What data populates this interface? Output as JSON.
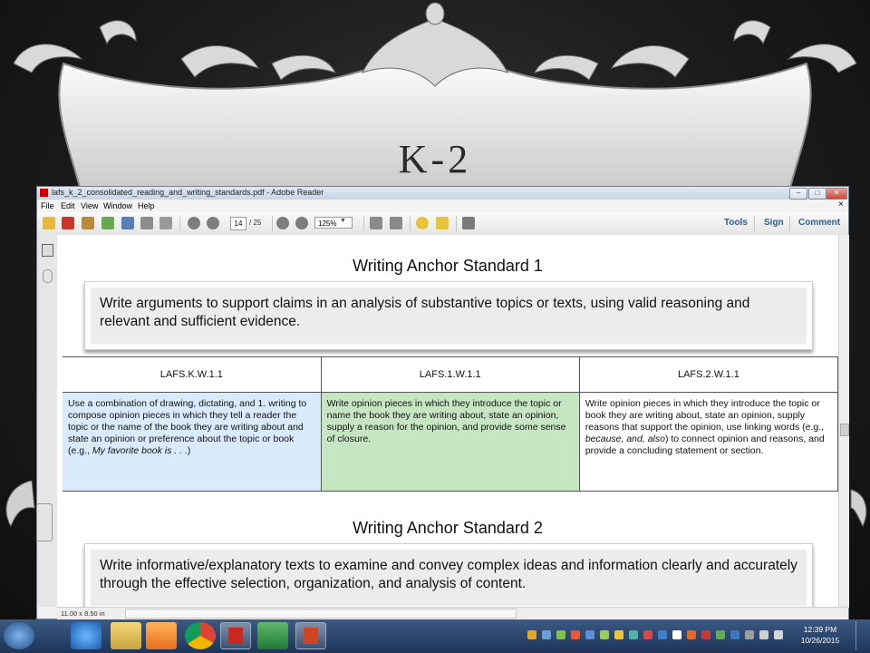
{
  "slide": {
    "title": "K-2"
  },
  "window": {
    "title": "lafs_k_2_consolidated_reading_and_writing_standards.pdf - Adobe Reader",
    "min": "–",
    "max": "□",
    "close": "✕",
    "doc_close": "×"
  },
  "menu": [
    "File",
    "Edit",
    "View",
    "Window",
    "Help"
  ],
  "toolbar": {
    "page_current": "14",
    "page_total": "/ 25",
    "zoom": "125%",
    "tools": "Tools",
    "sign": "Sign",
    "comment": "Comment"
  },
  "document": {
    "standard1": {
      "heading": "Writing Anchor Standard 1",
      "text": "Write arguments to support claims in an analysis of substantive topics or texts, using valid reasoning and relevant and sufficient evidence."
    },
    "table": {
      "headers": [
        "LAFS.K.W.1.1",
        "LAFS.1.W.1.1",
        "LAFS.2.W.1.1"
      ],
      "cells": [
        {
          "text": "Use a combination of drawing, dictating, and 1. writing to compose opinion pieces in which they tell a reader the topic or the name of the book they are writing about and state an opinion or preference about the topic or book (e.g., ",
          "italic": "My favorite book is . . .",
          "end": ")"
        },
        {
          "text": "Write opinion pieces in which they introduce the topic or name the book they are writing about, state an opinion, supply a reason for the opinion, and provide some sense of closure."
        },
        {
          "text": "Write opinion pieces in which they introduce the topic or book they are writing about, state an opinion, supply reasons that support the opinion, use linking words (e.g., ",
          "italic": "because, and, also",
          "end": ") to connect opinion and reasons, and provide a concluding statement or section."
        }
      ]
    },
    "standard2": {
      "heading": "Writing Anchor Standard 2",
      "text": "Write informative/explanatory texts to examine and convey complex ideas and information clearly and accurately through the effective selection, organization, and analysis of content."
    }
  },
  "statusbar": {
    "page_size": "11.00 x 8.50 in"
  },
  "taskbar": {
    "time": "12:39 PM",
    "date": "10/26/2015"
  },
  "colors": {
    "col_k": "#d9ebfa",
    "col_1": "#c6e6c2",
    "col_2": "#ffffff",
    "toolbar_link": "#2d5c91",
    "taskbar": "#2a4670"
  }
}
